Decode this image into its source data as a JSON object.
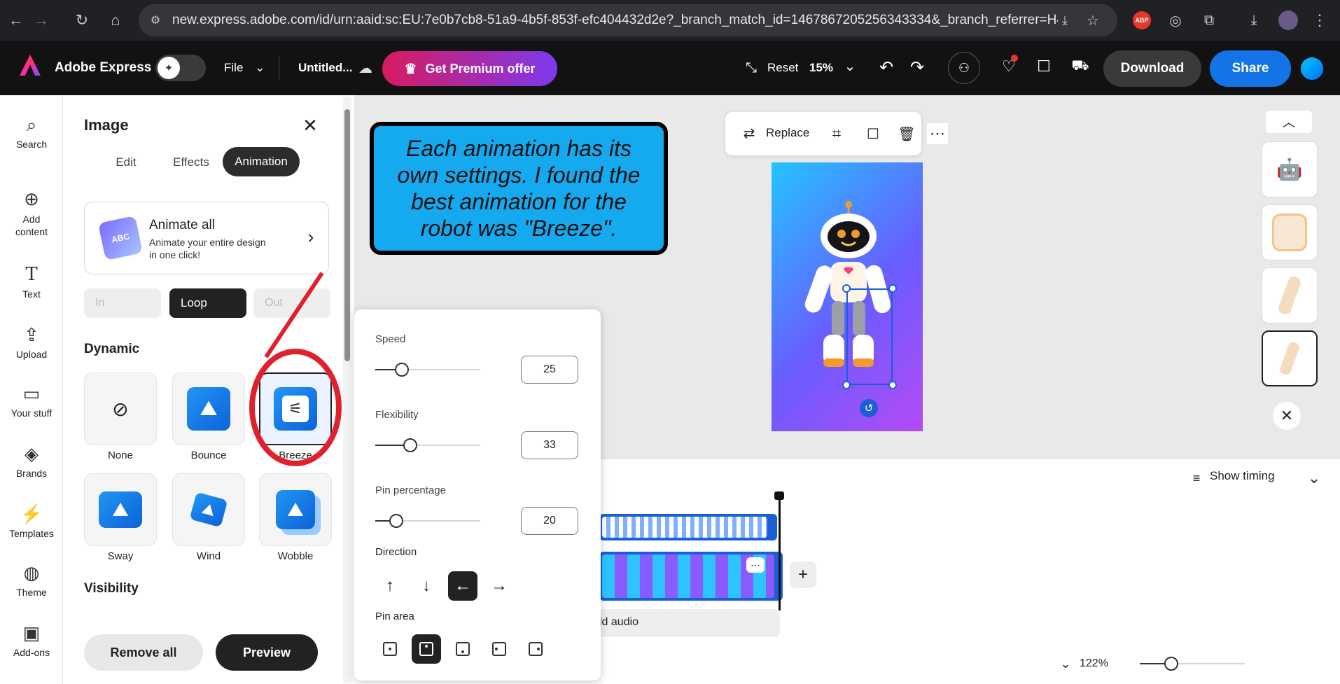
{
  "browser": {
    "url": "new.express.adobe.com/id/urn:aaid:sc:EU:7e0b7cb8-51a9-4b5f-853f-efc404432d2e?_branch_match_id=1467867205256343334&_branch_referrer=H4sIAA...",
    "ext_badge": "ABP"
  },
  "header": {
    "app_name": "Adobe Express",
    "file_label": "File",
    "doc_title": "Untitled...",
    "premium_label": "Get Premium offer",
    "reset_label": "Reset",
    "zoom": "15%",
    "download_label": "Download",
    "share_label": "Share"
  },
  "rail": [
    {
      "label": "Search",
      "icon": "⌕"
    },
    {
      "label": "Add content",
      "icon": "⊕"
    },
    {
      "label": "Text",
      "icon": "T"
    },
    {
      "label": "Upload",
      "icon": "⇪"
    },
    {
      "label": "Your stuff",
      "icon": "▭"
    },
    {
      "label": "Brands",
      "icon": "◈"
    },
    {
      "label": "Templates",
      "icon": "⚡"
    },
    {
      "label": "Theme",
      "icon": "◍"
    },
    {
      "label": "Add-ons",
      "icon": "▣"
    }
  ],
  "panel": {
    "title": "Image",
    "tabs": [
      "Edit",
      "Effects",
      "Animation"
    ],
    "animate_all_title": "Animate all",
    "animate_all_desc": "Animate your entire design in one click!",
    "animate_all_badge": "ABC",
    "segments": [
      "In",
      "Loop",
      "Out"
    ],
    "dynamic_heading": "Dynamic",
    "tiles": [
      "None",
      "Bounce",
      "Breeze",
      "Sway",
      "Wind",
      "Wobble"
    ],
    "visibility_heading": "Visibility",
    "remove_all_label": "Remove all",
    "preview_label": "Preview"
  },
  "settings": {
    "speed_label": "Speed",
    "speed_value": "25",
    "speed_level": 0.25,
    "flex_label": "Flexibility",
    "flex_value": "33",
    "flex_level": 0.33,
    "pin_label": "Pin percentage",
    "pin_value": "20",
    "pin_level": 0.2,
    "direction_label": "Direction",
    "directions": [
      "↑",
      "↓",
      "←",
      "→"
    ],
    "pin_area_label": "Pin area"
  },
  "canvas": {
    "replace_label": "Replace",
    "callout_text": "Each animation has its own settings. I found the best animation for the robot was \"Breeze\"."
  },
  "timeline": {
    "show_timing_label": "Show timing",
    "add_audio_label": "ld audio",
    "zoom_label": "122%",
    "zoom_level": 0.3
  },
  "colors": {
    "accent_blue": "#1473e6",
    "premium_gradient": "#c2185b",
    "callout_fill": "#15a9ef",
    "annotation_red": "#e0212d"
  }
}
